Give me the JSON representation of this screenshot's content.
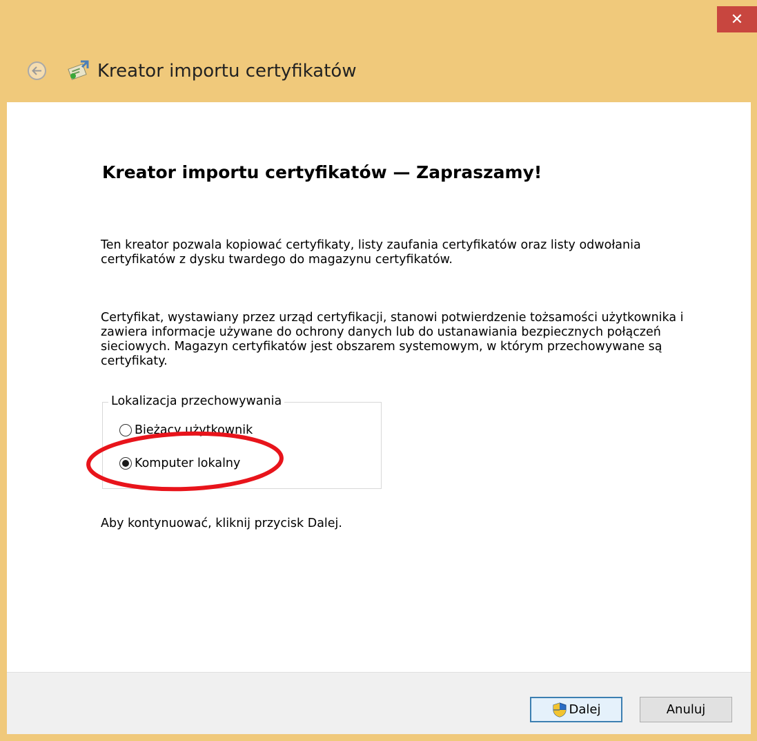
{
  "window": {
    "title": "Kreator importu certyfikatów",
    "close_glyph": "✕",
    "title_bar_color": "#f0c97b",
    "close_color": "#c8463f"
  },
  "icons": {
    "back": "back-arrow-icon",
    "wizard": "certificate-wizard-icon",
    "shield": "uac-shield-icon"
  },
  "main": {
    "heading": "Kreator importu certyfikatów — Zapraszamy!",
    "paragraph1": "Ten kreator pozwala kopiować certyfikaty, listy zaufania certyfikatów oraz listy odwołania certyfikatów z dysku twardego do magazynu certyfikatów.",
    "paragraph2": "Certyfikat, wystawiany przez urząd certyfikacji, stanowi potwierdzenie tożsamości użytkownika i zawiera informacje używane do ochrony danych lub do ustanawiania bezpiecznych połączeń sieciowych. Magazyn certyfikatów jest obszarem systemowym, w którym przechowywane są certyfikaty.",
    "continue_hint": "Aby kontynuować, kliknij przycisk Dalej."
  },
  "storage_location": {
    "legend": "Lokalizacja przechowywania",
    "options": [
      {
        "label": "Bieżący użytkownik",
        "selected": false
      },
      {
        "label": "Komputer lokalny",
        "selected": true
      }
    ],
    "annotation_color": "#e8141b"
  },
  "footer": {
    "next_label": "Dalej",
    "cancel_label": "Anuluj"
  }
}
